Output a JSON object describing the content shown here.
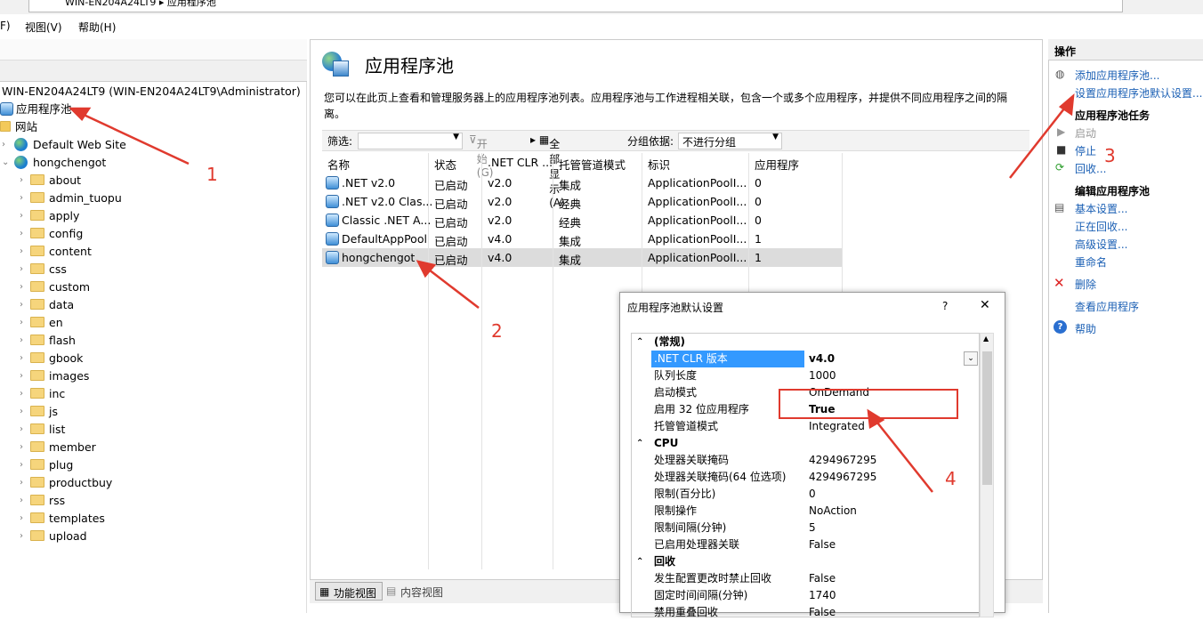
{
  "address": {
    "text": "WIN-EN204A24LT9 ▸ 应用程序池"
  },
  "menu": {
    "file": "F)",
    "view": "视图(V)",
    "help": "帮助(H)"
  },
  "tree": {
    "server": "WIN-EN204A24LT9 (WIN-EN204A24LT9\\Administrator)",
    "apppools": "应用程序池",
    "sites": "网站",
    "default_site": "Default Web Site",
    "site2": "hongchengot",
    "folders": [
      "about",
      "admin_tuopu",
      "apply",
      "config",
      "content",
      "css",
      "custom",
      "data",
      "en",
      "flash",
      "gbook",
      "images",
      "inc",
      "js",
      "list",
      "member",
      "plug",
      "productbuy",
      "rss",
      "templates",
      "upload"
    ]
  },
  "center": {
    "title": "应用程序池",
    "description": "您可以在此页上查看和管理服务器上的应用程序池列表。应用程序池与工作进程相关联，包含一个或多个应用程序，并提供不同应用程序之间的隔离。",
    "filter_label": "筛选:",
    "start_label": "开始(G)",
    "show_all_label": "全部显示(A)",
    "group_label": "分组依据:",
    "group_value": "不进行分组",
    "columns": [
      "名称",
      "状态",
      ".NET CLR ...",
      "托管管道模式",
      "标识",
      "应用程序"
    ],
    "rows": [
      [
        ".NET v2.0",
        "已启动",
        "v2.0",
        "集成",
        "ApplicationPoolI...",
        "0"
      ],
      [
        ".NET v2.0 Clas...",
        "已启动",
        "v2.0",
        "经典",
        "ApplicationPoolI...",
        "0"
      ],
      [
        "Classic .NET A...",
        "已启动",
        "v2.0",
        "经典",
        "ApplicationPoolI...",
        "0"
      ],
      [
        "DefaultAppPool",
        "已启动",
        "v4.0",
        "集成",
        "ApplicationPoolI...",
        "1"
      ],
      [
        "hongchengot",
        "已启动",
        "v4.0",
        "集成",
        "ApplicationPoolI...",
        "1"
      ]
    ],
    "features_view": "功能视图",
    "content_view": "内容视图"
  },
  "actions": {
    "title": "操作",
    "add_pool": "添加应用程序池...",
    "set_defaults": "设置应用程序池默认设置...",
    "tasks_title": "应用程序池任务",
    "start": "启动",
    "stop": "停止",
    "recycle": "回收...",
    "edit_title": "编辑应用程序池",
    "basic": "基本设置...",
    "recycling": "正在回收...",
    "advanced": "高级设置...",
    "rename": "重命名",
    "delete": "删除",
    "view_apps": "查看应用程序",
    "help": "帮助"
  },
  "dialog": {
    "title": "应用程序池默认设置",
    "help": "?",
    "close": "✕",
    "rows": [
      {
        "sec": true,
        "k": "(常规)",
        "v": ""
      },
      {
        "k": ".NET CLR 版本",
        "v": "v4.0",
        "selected": true
      },
      {
        "k": "队列长度",
        "v": "1000"
      },
      {
        "k": "启动模式",
        "v": "OnDemand"
      },
      {
        "k": "启用 32 位应用程序",
        "v": "True",
        "bold": true
      },
      {
        "k": "托管管道模式",
        "v": "Integrated"
      },
      {
        "sec": true,
        "k": "CPU",
        "v": ""
      },
      {
        "k": "处理器关联掩码",
        "v": "4294967295"
      },
      {
        "k": "处理器关联掩码(64 位选项)",
        "v": "4294967295"
      },
      {
        "k": "限制(百分比)",
        "v": "0"
      },
      {
        "k": "限制操作",
        "v": "NoAction"
      },
      {
        "k": "限制间隔(分钟)",
        "v": "5"
      },
      {
        "k": "已启用处理器关联",
        "v": "False"
      },
      {
        "sec": true,
        "k": "回收",
        "v": ""
      },
      {
        "k": "发生配置更改时禁止回收",
        "v": "False"
      },
      {
        "k": "固定时间间隔(分钟)",
        "v": "1740"
      },
      {
        "k": "禁用重叠回收",
        "v": "False"
      }
    ]
  },
  "annotations": {
    "n1": "1",
    "n2": "2",
    "n3": "3",
    "n4": "4"
  },
  "colors": {
    "annotation": "#e03a2e",
    "link": "#1a5fb4",
    "selection": "#3399ff"
  }
}
